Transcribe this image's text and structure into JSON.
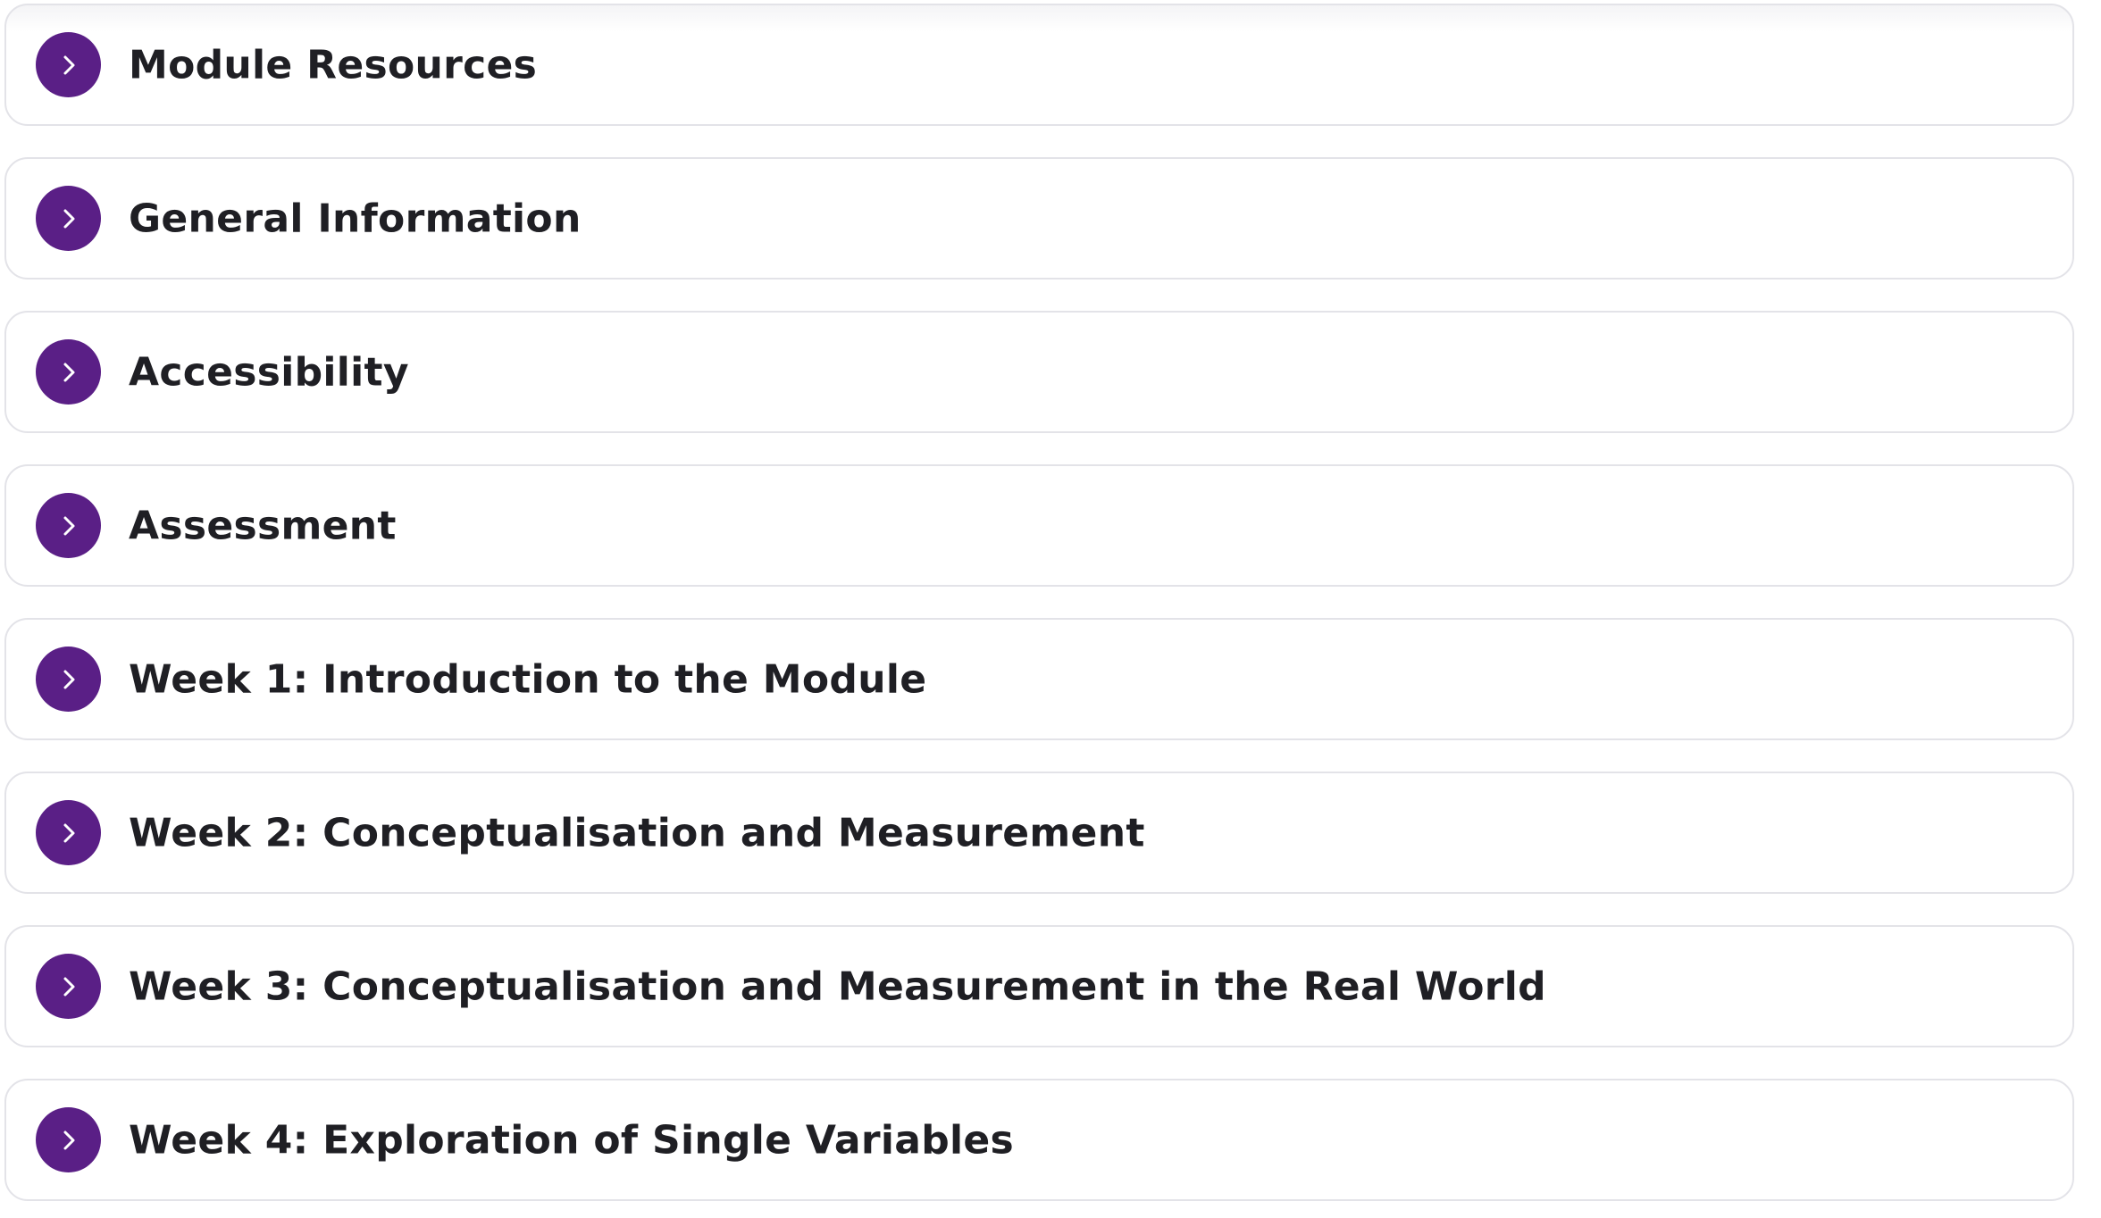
{
  "colors": {
    "accent": "#5a1f86",
    "text": "#1f1f24",
    "border": "#e3e3e8",
    "background": "#ffffff"
  },
  "sections": [
    {
      "label": "Module Resources",
      "icon": "chevron-right-icon"
    },
    {
      "label": "General Information",
      "icon": "chevron-right-icon"
    },
    {
      "label": "Accessibility",
      "icon": "chevron-right-icon"
    },
    {
      "label": "Assessment",
      "icon": "chevron-right-icon"
    },
    {
      "label": "Week 1: Introduction to the Module",
      "icon": "chevron-right-icon"
    },
    {
      "label": "Week 2: Conceptualisation and Measurement",
      "icon": "chevron-right-icon"
    },
    {
      "label": "Week 3: Conceptualisation and Measurement in the Real World",
      "icon": "chevron-right-icon"
    },
    {
      "label": "Week 4: Exploration of Single Variables",
      "icon": "chevron-right-icon"
    }
  ]
}
